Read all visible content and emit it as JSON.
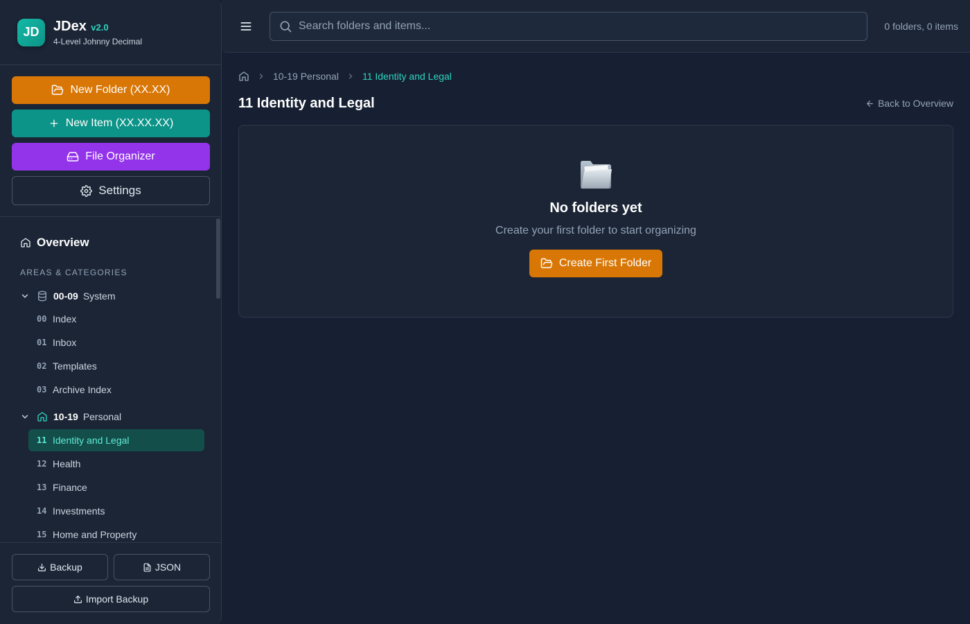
{
  "app": {
    "logo_text": "JD",
    "name": "JDex",
    "version": "v2.0",
    "subtitle": "4-Level Johnny Decimal"
  },
  "actions": {
    "new_folder": "New Folder (XX.XX)",
    "new_item": "New Item (XX.XX.XX)",
    "file_organizer": "File Organizer",
    "settings": "Settings"
  },
  "nav": {
    "overview": "Overview",
    "section_label": "AREAS & CATEGORIES",
    "areas": [
      {
        "code": "00-09",
        "name": "System",
        "icon": "database-icon",
        "expanded": true,
        "categories": [
          {
            "num": "00",
            "name": "Index"
          },
          {
            "num": "01",
            "name": "Inbox"
          },
          {
            "num": "02",
            "name": "Templates"
          },
          {
            "num": "03",
            "name": "Archive Index"
          }
        ]
      },
      {
        "code": "10-19",
        "name": "Personal",
        "icon": "home-icon",
        "expanded": true,
        "categories": [
          {
            "num": "11",
            "name": "Identity and Legal",
            "active": true
          },
          {
            "num": "12",
            "name": "Health"
          },
          {
            "num": "13",
            "name": "Finance"
          },
          {
            "num": "14",
            "name": "Investments"
          },
          {
            "num": "15",
            "name": "Home and Property"
          }
        ]
      }
    ]
  },
  "footer": {
    "backup": "Backup",
    "json": "JSON",
    "import": "Import Backup"
  },
  "topbar": {
    "search_placeholder": "Search folders and items...",
    "counts": "0 folders, 0 items"
  },
  "breadcrumb": {
    "area": "10-19 Personal",
    "current": "11 Identity and Legal"
  },
  "page": {
    "title": "11 Identity and Legal",
    "back": "Back to Overview"
  },
  "empty": {
    "title": "No folders yet",
    "subtitle": "Create your first folder to start organizing",
    "button": "Create First Folder"
  },
  "colors": {
    "accent_teal": "#0d9488",
    "accent_orange": "#d97706",
    "accent_purple": "#9333ea",
    "background": "#172033"
  }
}
